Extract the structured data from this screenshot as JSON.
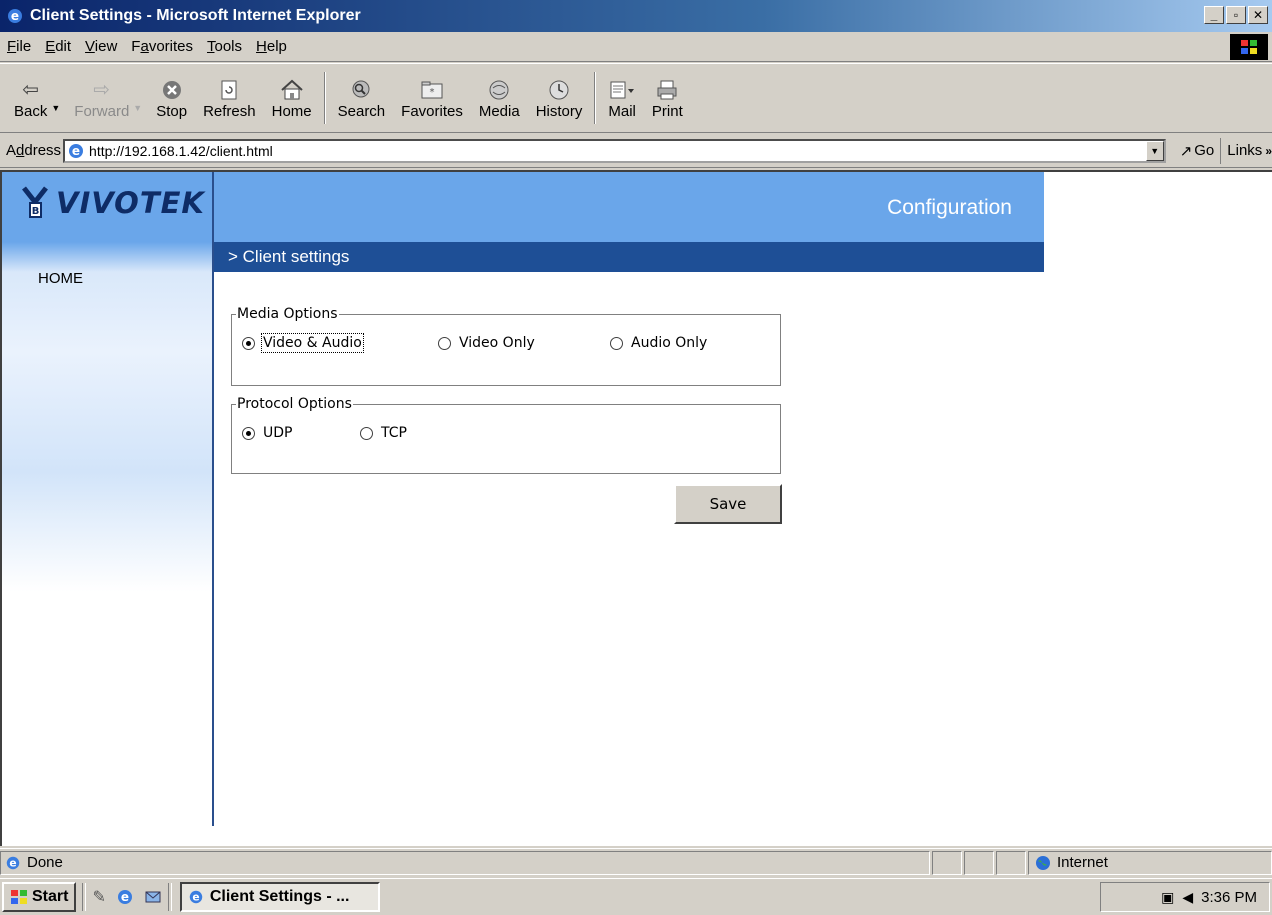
{
  "window": {
    "title": "Client Settings - Microsoft Internet Explorer"
  },
  "menu": {
    "items": [
      {
        "label": "File",
        "key": "F",
        "rest": "ile"
      },
      {
        "label": "Edit",
        "key": "E",
        "rest": "dit"
      },
      {
        "label": "View",
        "key": "V",
        "rest": "iew"
      },
      {
        "label": "Favorites",
        "pre": "F",
        "key": "a",
        "rest": "vorites"
      },
      {
        "label": "Tools",
        "key": "T",
        "rest": "ools"
      },
      {
        "label": "Help",
        "key": "H",
        "rest": "elp"
      }
    ]
  },
  "toolbar": {
    "back": "Back",
    "forward": "Forward",
    "stop": "Stop",
    "refresh": "Refresh",
    "home": "Home",
    "search": "Search",
    "favorites": "Favorites",
    "media": "Media",
    "history": "History",
    "mail": "Mail",
    "print": "Print"
  },
  "address": {
    "label_pre": "A",
    "label_key": "d",
    "label_rest": "dress",
    "url": "http://192.168.1.42/client.html",
    "go": "Go",
    "links": "Links"
  },
  "page": {
    "logo": "VIVOTEK",
    "header": "Configuration",
    "nav_home": "HOME",
    "section_title": "> Client settings",
    "media": {
      "legend": "Media Options",
      "options": [
        "Video & Audio",
        "Video Only",
        "Audio Only"
      ],
      "selected": "Video & Audio"
    },
    "protocol": {
      "legend": "Protocol Options",
      "options": [
        "UDP",
        "TCP"
      ],
      "selected": "UDP"
    },
    "save": "Save"
  },
  "status": {
    "text": "Done",
    "zone": "Internet"
  },
  "taskbar": {
    "start": "Start",
    "task": "Client Settings - ...",
    "clock": "3:36 PM"
  },
  "colors": {
    "header_blue": "#6aa6ea",
    "subheader_blue": "#1e4f96",
    "logo_navy": "#0e2c66"
  }
}
